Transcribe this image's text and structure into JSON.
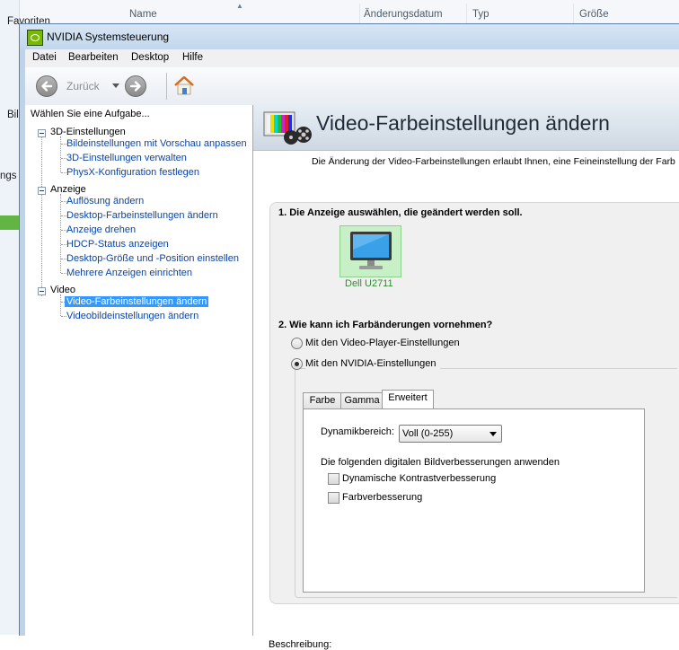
{
  "background": {
    "columns": [
      "Name",
      "Änderungsdatum",
      "Typ",
      "Größe"
    ],
    "sidebar_fragments": [
      "Favoriten",
      "Bil",
      "ngs"
    ]
  },
  "window": {
    "title": "NVIDIA Systemsteuerung"
  },
  "menu": [
    "Datei",
    "Bearbeiten",
    "Desktop",
    "Hilfe"
  ],
  "toolbar": {
    "back_label": "Zurück"
  },
  "task_pane": {
    "header": "Wählen Sie eine Aufgabe...",
    "categories": [
      {
        "label": "3D-Einstellungen",
        "items": [
          "Bildeinstellungen mit Vorschau anpassen",
          "3D-Einstellungen verwalten",
          "PhysX-Konfiguration festlegen"
        ]
      },
      {
        "label": "Anzeige",
        "items": [
          "Auflösung ändern",
          "Desktop-Farbeinstellungen ändern",
          "Anzeige drehen",
          "HDCP-Status anzeigen",
          "Desktop-Größe und -Position einstellen",
          "Mehrere Anzeigen einrichten"
        ]
      },
      {
        "label": "Video",
        "items": [
          "Video-Farbeinstellungen ändern",
          "Videobildeinstellungen ändern"
        ]
      }
    ],
    "selected": "Video-Farbeinstellungen ändern"
  },
  "content": {
    "title": "Video-Farbeinstellungen ändern",
    "intro": "Die Änderung der Video-Farbeinstellungen erlaubt Ihnen, eine Feineinstellung der Farb",
    "step1": "1. Die Anzeige auswählen, die geändert werden soll.",
    "display_name": "Dell U2711",
    "step2": "2. Wie kann ich Farbänderungen vornehmen?",
    "radio_player": "Mit den Video-Player-Einstellungen",
    "radio_nvidia": "Mit den NVIDIA-Einstellungen",
    "radio_selected": "nvidia",
    "tabs": [
      "Farbe",
      "Gamma",
      "Erweitert"
    ],
    "active_tab": "Erweitert",
    "dynamic_range_label": "Dynamikbereich:",
    "dynamic_range_value": "Voll (0-255)",
    "enhancements_label": "Die folgenden digitalen Bildverbesserungen anwenden",
    "checkbox_contrast": "Dynamische Kontrastverbesserung",
    "checkbox_color": "Farbverbesserung",
    "description_label": "Beschreibung:"
  },
  "colors": {
    "link": "#0b44a8",
    "selection": "#3399ff",
    "nvidia_green": "#76b900",
    "display_label": "#2e8b2e"
  }
}
